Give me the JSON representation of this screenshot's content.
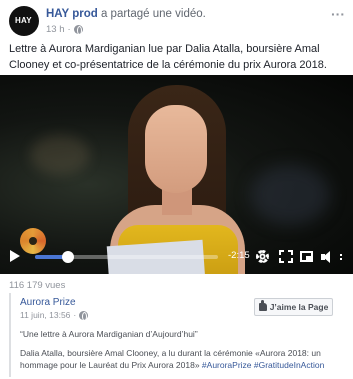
{
  "post": {
    "page_name": "HAY prod",
    "action_text": "a partagé une vidéo.",
    "time": "13 h",
    "avatar_text": "HAY",
    "caption": "Lettre à Aurora Mardiganian lue par Dalia Atalla, boursière Amal Clooney et co-présentatrice de la cérémonie du prix Aurora 2018."
  },
  "video": {
    "progress_fraction": 0.18,
    "time_remaining": "-2:15"
  },
  "views": "116 179 vues",
  "embed": {
    "page_name": "Aurora Prize",
    "date": "11 juin, 13:56",
    "like_button": "J’aime la Page",
    "quote": "“Une lettre à Aurora Mardiganian d’Aujourd’hui”",
    "desc_text": "Dalia Atalla, boursière Amal Clooney, a lu durant la cérémonie «Aurora 2018: un hommage pour le Lauréat du Prix Aurora 2018» ",
    "hashtags": "#AuroraPrize #GratitudeInAction"
  },
  "icons": [
    "globe-icon",
    "more-options-icon",
    "play-icon",
    "settings-icon",
    "fullscreen-icon",
    "pip-icon",
    "volume-icon",
    "thumbs-up-icon"
  ],
  "colors": {
    "link": "#365899",
    "progress": "#4a76d4",
    "muted": "#90949c"
  }
}
